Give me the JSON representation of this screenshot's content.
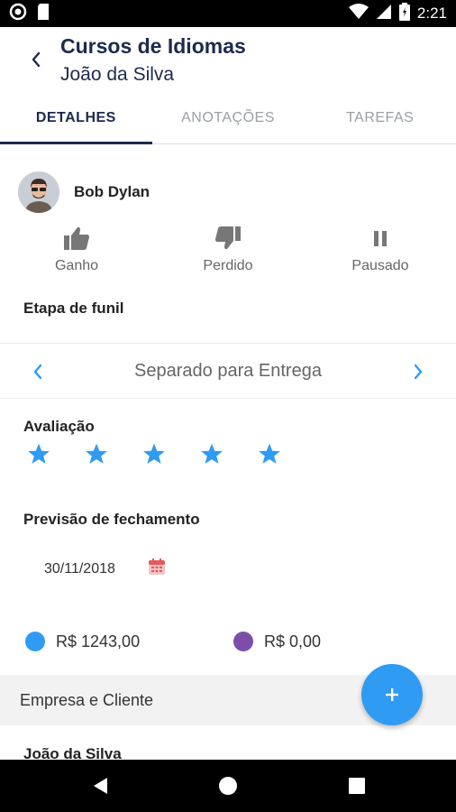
{
  "status_bar": {
    "time": "2:21",
    "icons": [
      "record-icon",
      "sd-card-icon",
      "wifi-icon",
      "signal-icon",
      "battery-icon"
    ]
  },
  "header": {
    "title": "Cursos de Idiomas",
    "subtitle": "João da Silva"
  },
  "tabs": [
    {
      "label": "DETALHES",
      "active": true
    },
    {
      "label": "ANOTAÇÕES",
      "active": false
    },
    {
      "label": "TAREFAS",
      "active": false
    }
  ],
  "contact": {
    "name": "Bob Dylan"
  },
  "actions": [
    {
      "label": "Ganho",
      "icon": "thumbs-up-icon"
    },
    {
      "label": "Perdido",
      "icon": "thumbs-down-icon"
    },
    {
      "label": "Pausado",
      "icon": "pause-icon"
    }
  ],
  "funnel": {
    "label": "Etapa de funil",
    "current_stage": "Separado para Entrega"
  },
  "rating": {
    "label": "Avaliação",
    "stars": 5,
    "max_stars": 5
  },
  "closing": {
    "label": "Previsão de fechamento",
    "date": "30/11/2018"
  },
  "amounts": [
    {
      "value": "R$ 1243,00",
      "color": "#2f9bf3"
    },
    {
      "value": "R$ 0,00",
      "color": "#7b4fa8"
    }
  ],
  "section": {
    "title": "Empresa e Cliente"
  },
  "fab": {
    "label": "+"
  },
  "next_item": {
    "name": "João da Silva"
  },
  "colors": {
    "accent": "#2f9bf3",
    "title": "#1d2a4d"
  }
}
